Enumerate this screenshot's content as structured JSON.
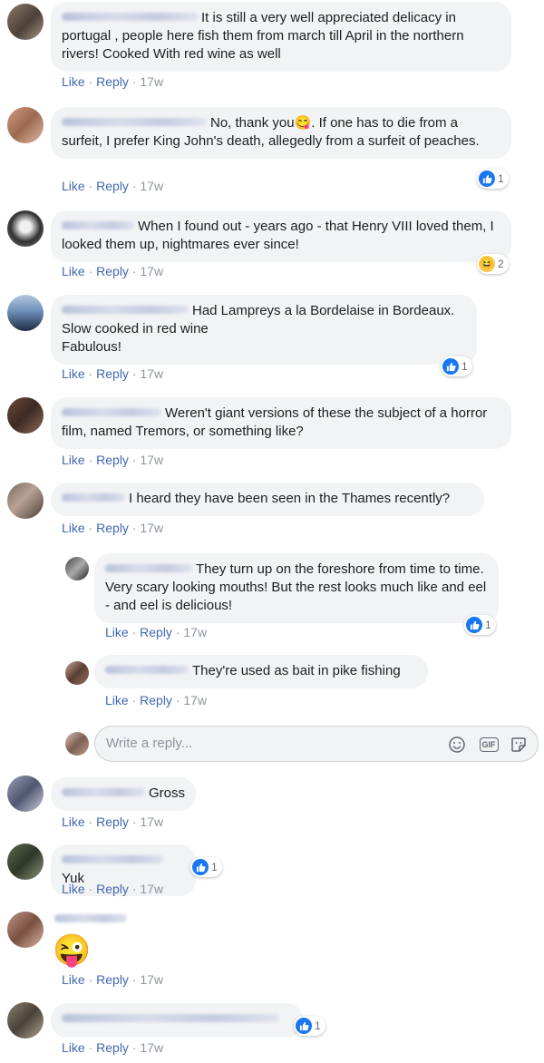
{
  "actions": {
    "like": "Like",
    "reply": "Reply",
    "sep": "·"
  },
  "comments": [
    {
      "text": "It is still a very well appreciated delicacy in portugal , people here fish them from march till April in the northern rivers! Cooked With red wine as well",
      "time": "17w"
    },
    {
      "text": "No, thank you😋. If one has to die from a surfeit, I prefer King John's death, allegedly from a surfeit of peaches.",
      "time": "17w",
      "reaction": {
        "type": "like",
        "count": "1"
      }
    },
    {
      "text": "When I found out - years ago - that Henry VIII loved them, I looked them up, nightmares ever since!",
      "time": "17w",
      "reaction": {
        "type": "haha",
        "count": "2"
      }
    },
    {
      "lines": [
        "Had Lampreys a la Bordelaise in Bordeaux.",
        "Slow cooked in red wine",
        "Fabulous!"
      ],
      "time": "17w",
      "reaction": {
        "type": "like",
        "count": "1"
      }
    },
    {
      "text": "Weren't giant versions of these the subject of a horror film, named Tremors, or something like?",
      "time": "17w"
    },
    {
      "text": "I heard they have been seen in the Thames recently?",
      "time": "17w",
      "replies": [
        {
          "text": "They turn up on the foreshore from time to time. Very scary looking mouths! But the rest looks much like and eel - and eel is delicious!",
          "time": "17w",
          "reaction": {
            "type": "like",
            "count": "1"
          }
        },
        {
          "text": "They're used as bait in pike fishing",
          "time": "17w"
        }
      ]
    },
    {
      "text": "Gross",
      "time": "17w"
    },
    {
      "text": "Yuk",
      "time": "17w",
      "reaction": {
        "type": "like",
        "count": "1"
      }
    },
    {
      "emoji": "😜",
      "time": "17w"
    },
    {
      "text": "",
      "time": "17w",
      "reaction": {
        "type": "like",
        "count": "1"
      }
    }
  ],
  "reply_box": {
    "placeholder": "Write a reply...",
    "gif_label": "GIF"
  },
  "colors": {
    "link": "#4267b2",
    "bubble": "#f2f3f5",
    "like": "#1877f2",
    "meta": "#8d949e"
  }
}
